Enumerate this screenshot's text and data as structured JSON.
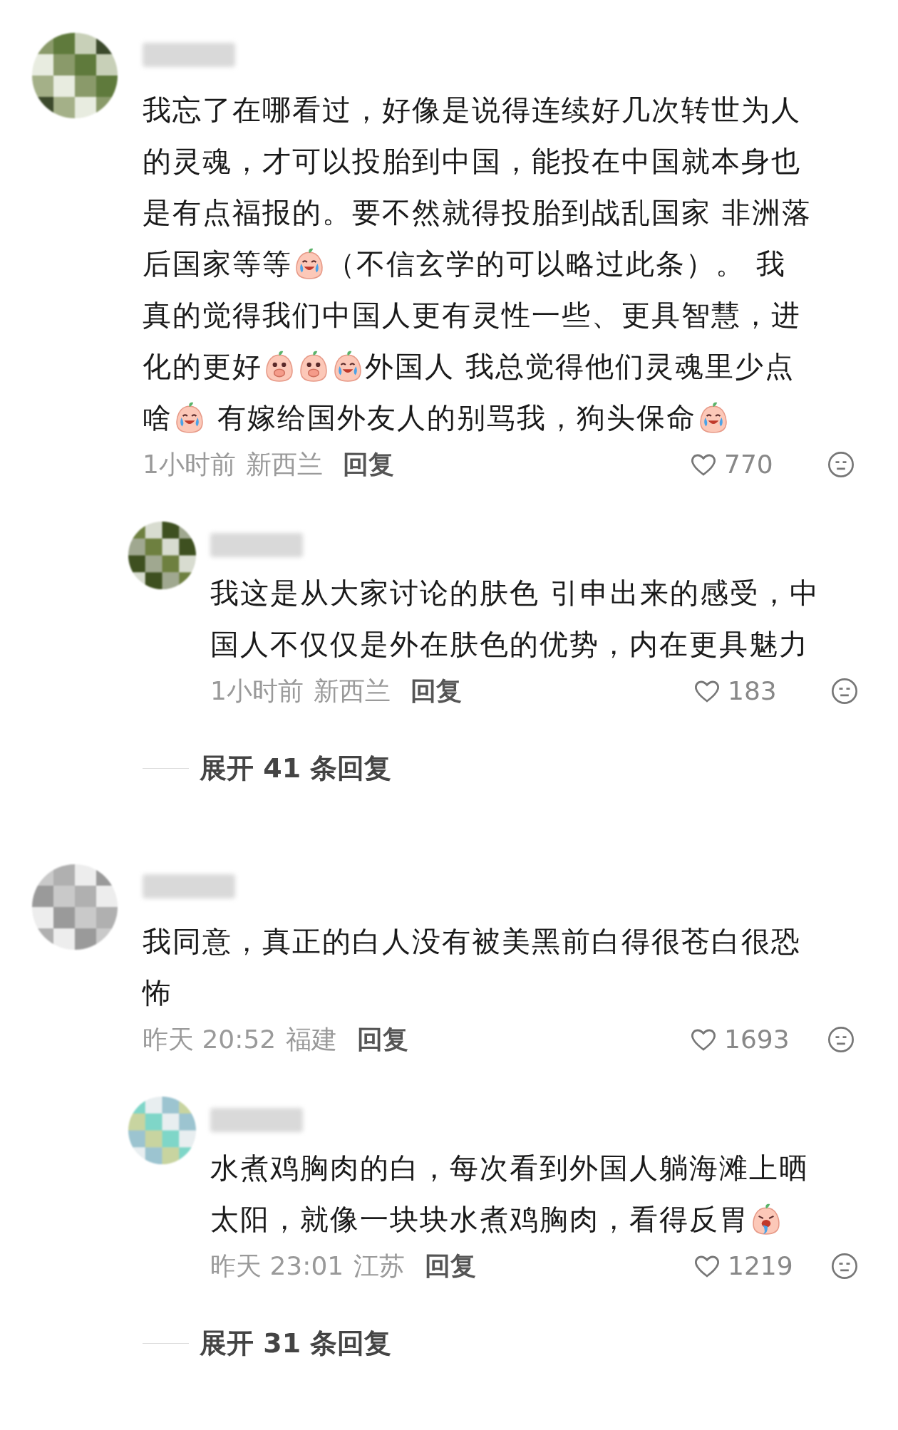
{
  "threads": [
    {
      "comment": {
        "lines": [
          [
            {
              "kind": "text",
              "text": "我忘了在哪看过，好像是说得连续好几次转世为人"
            }
          ],
          [
            {
              "kind": "text",
              "text": "的灵魂，才可以投胎到中国，能投在中国就本身也"
            }
          ],
          [
            {
              "kind": "text",
              "text": "是有点福报的。要不然就得投胎到战乱国家 非洲落"
            }
          ],
          [
            {
              "kind": "text",
              "text": "后国家等等"
            },
            {
              "kind": "cry"
            },
            {
              "kind": "text",
              "text": "（不信玄学的可以略过此条）。 我"
            }
          ],
          [
            {
              "kind": "text",
              "text": "真的觉得我们中国人更有灵性一些、更具智慧，进"
            }
          ],
          [
            {
              "kind": "text",
              "text": "化的更好"
            },
            {
              "kind": "cover"
            },
            {
              "kind": "cover"
            },
            {
              "kind": "cry"
            },
            {
              "kind": "text",
              "text": "外国人 我总觉得他们灵魂里少点"
            }
          ],
          [
            {
              "kind": "text",
              "text": "啥"
            },
            {
              "kind": "cry"
            },
            {
              "kind": "text",
              "text": " 有嫁给国外友人的别骂我，狗头保命"
            },
            {
              "kind": "cry"
            }
          ]
        ],
        "time": "1小时前",
        "location": "新西兰",
        "reply_label": "回复",
        "likes": "770"
      },
      "reply": {
        "lines": [
          [
            {
              "kind": "text",
              "text": "我这是从大家讨论的肤色 引申出来的感受，中"
            }
          ],
          [
            {
              "kind": "text",
              "text": "国人不仅仅是外在肤色的优势，内在更具魅力"
            }
          ]
        ],
        "time": "1小时前",
        "location": "新西兰",
        "reply_label": "回复",
        "likes": "183"
      },
      "expand": "展开 41 条回复"
    },
    {
      "comment": {
        "lines": [
          [
            {
              "kind": "text",
              "text": "我同意，真正的白人没有被美黑前白得很苍白很恐"
            }
          ],
          [
            {
              "kind": "text",
              "text": "怖"
            }
          ]
        ],
        "time": "昨天 20:52",
        "location": "福建",
        "reply_label": "回复",
        "likes": "1693"
      },
      "reply": {
        "lines": [
          [
            {
              "kind": "text",
              "text": "水煮鸡胸肉的白，每次看到外国人躺海滩上晒"
            }
          ],
          [
            {
              "kind": "text",
              "text": "太阳，就像一块块水煮鸡胸肉，看得反胃"
            },
            {
              "kind": "vomit"
            }
          ]
        ],
        "time": "昨天 23:01",
        "location": "江苏",
        "reply_label": "回复",
        "likes": "1219"
      },
      "expand": "展开 31 条回复"
    }
  ]
}
